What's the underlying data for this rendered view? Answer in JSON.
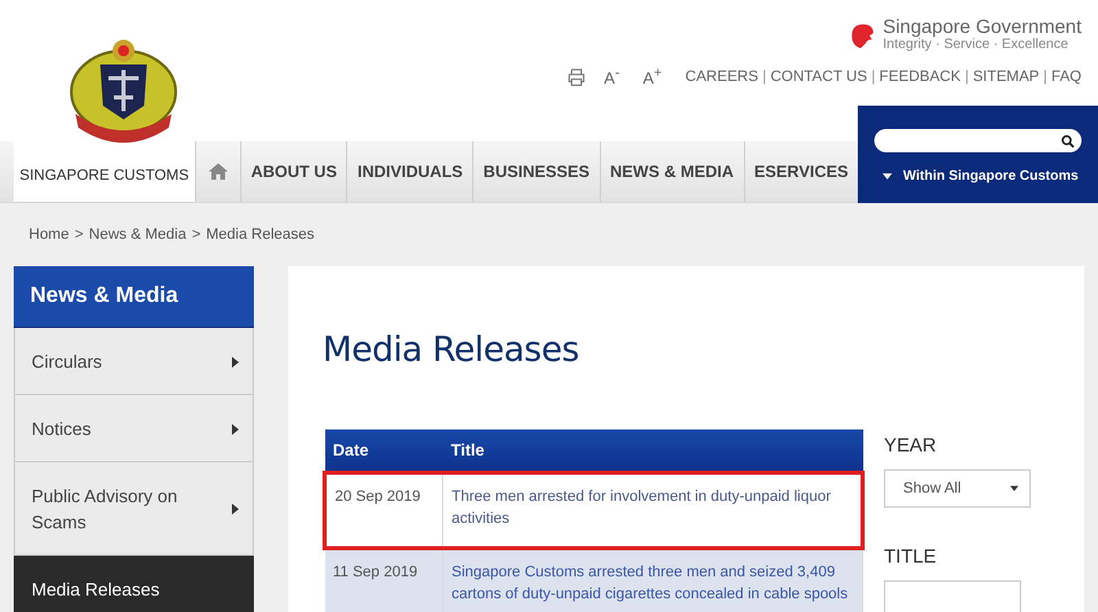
{
  "site": {
    "name": "SINGAPORE CUSTOMS"
  },
  "government": {
    "name": "Singapore Government",
    "motto": "Integrity · Service · Excellence"
  },
  "utility": {
    "text_size": [
      "A$^{-}$",
      "A$^{+}$"
    ],
    "links": [
      "CAREERS",
      "CONTACT US",
      "FEEDBACK",
      "SITEMAP",
      "FAQ"
    ],
    "separator": "|"
  },
  "nav": {
    "items": [
      "ABOUT US",
      "INDIVIDUALS",
      "BUSINESSES",
      "NEWS & MEDIA",
      "ESERVICES"
    ]
  },
  "search": {
    "scope": "Within Singapore Customs"
  },
  "breadcrumb": {
    "items": [
      "Home",
      "News & Media",
      "Media Releases"
    ],
    "separator": ">"
  },
  "sidebar": {
    "title": "News & Media",
    "items": [
      {
        "label": "Circulars",
        "selected": false
      },
      {
        "label": "Notices",
        "selected": false
      },
      {
        "label": "Public Advisory on Scams",
        "selected": false
      },
      {
        "label": "Media Releases",
        "selected": true
      }
    ]
  },
  "page_title": "Media Releases",
  "table": {
    "columns": [
      "Date",
      "Title"
    ],
    "rows": [
      {
        "date": "20 Sep 2019",
        "title": "Three men arrested for involvement in duty-unpaid liquor activities",
        "highlighted": true
      },
      {
        "date": "11 Sep 2019",
        "title": "Singapore Customs arrested three men and seized 3,409 cartons of duty-unpaid cigarettes concealed in cable spools",
        "highlighted": false
      }
    ]
  },
  "filters": [
    {
      "kind": "select",
      "label": "YEAR",
      "value": "Show All"
    },
    {
      "kind": "text",
      "label": "TITLE"
    }
  ]
}
